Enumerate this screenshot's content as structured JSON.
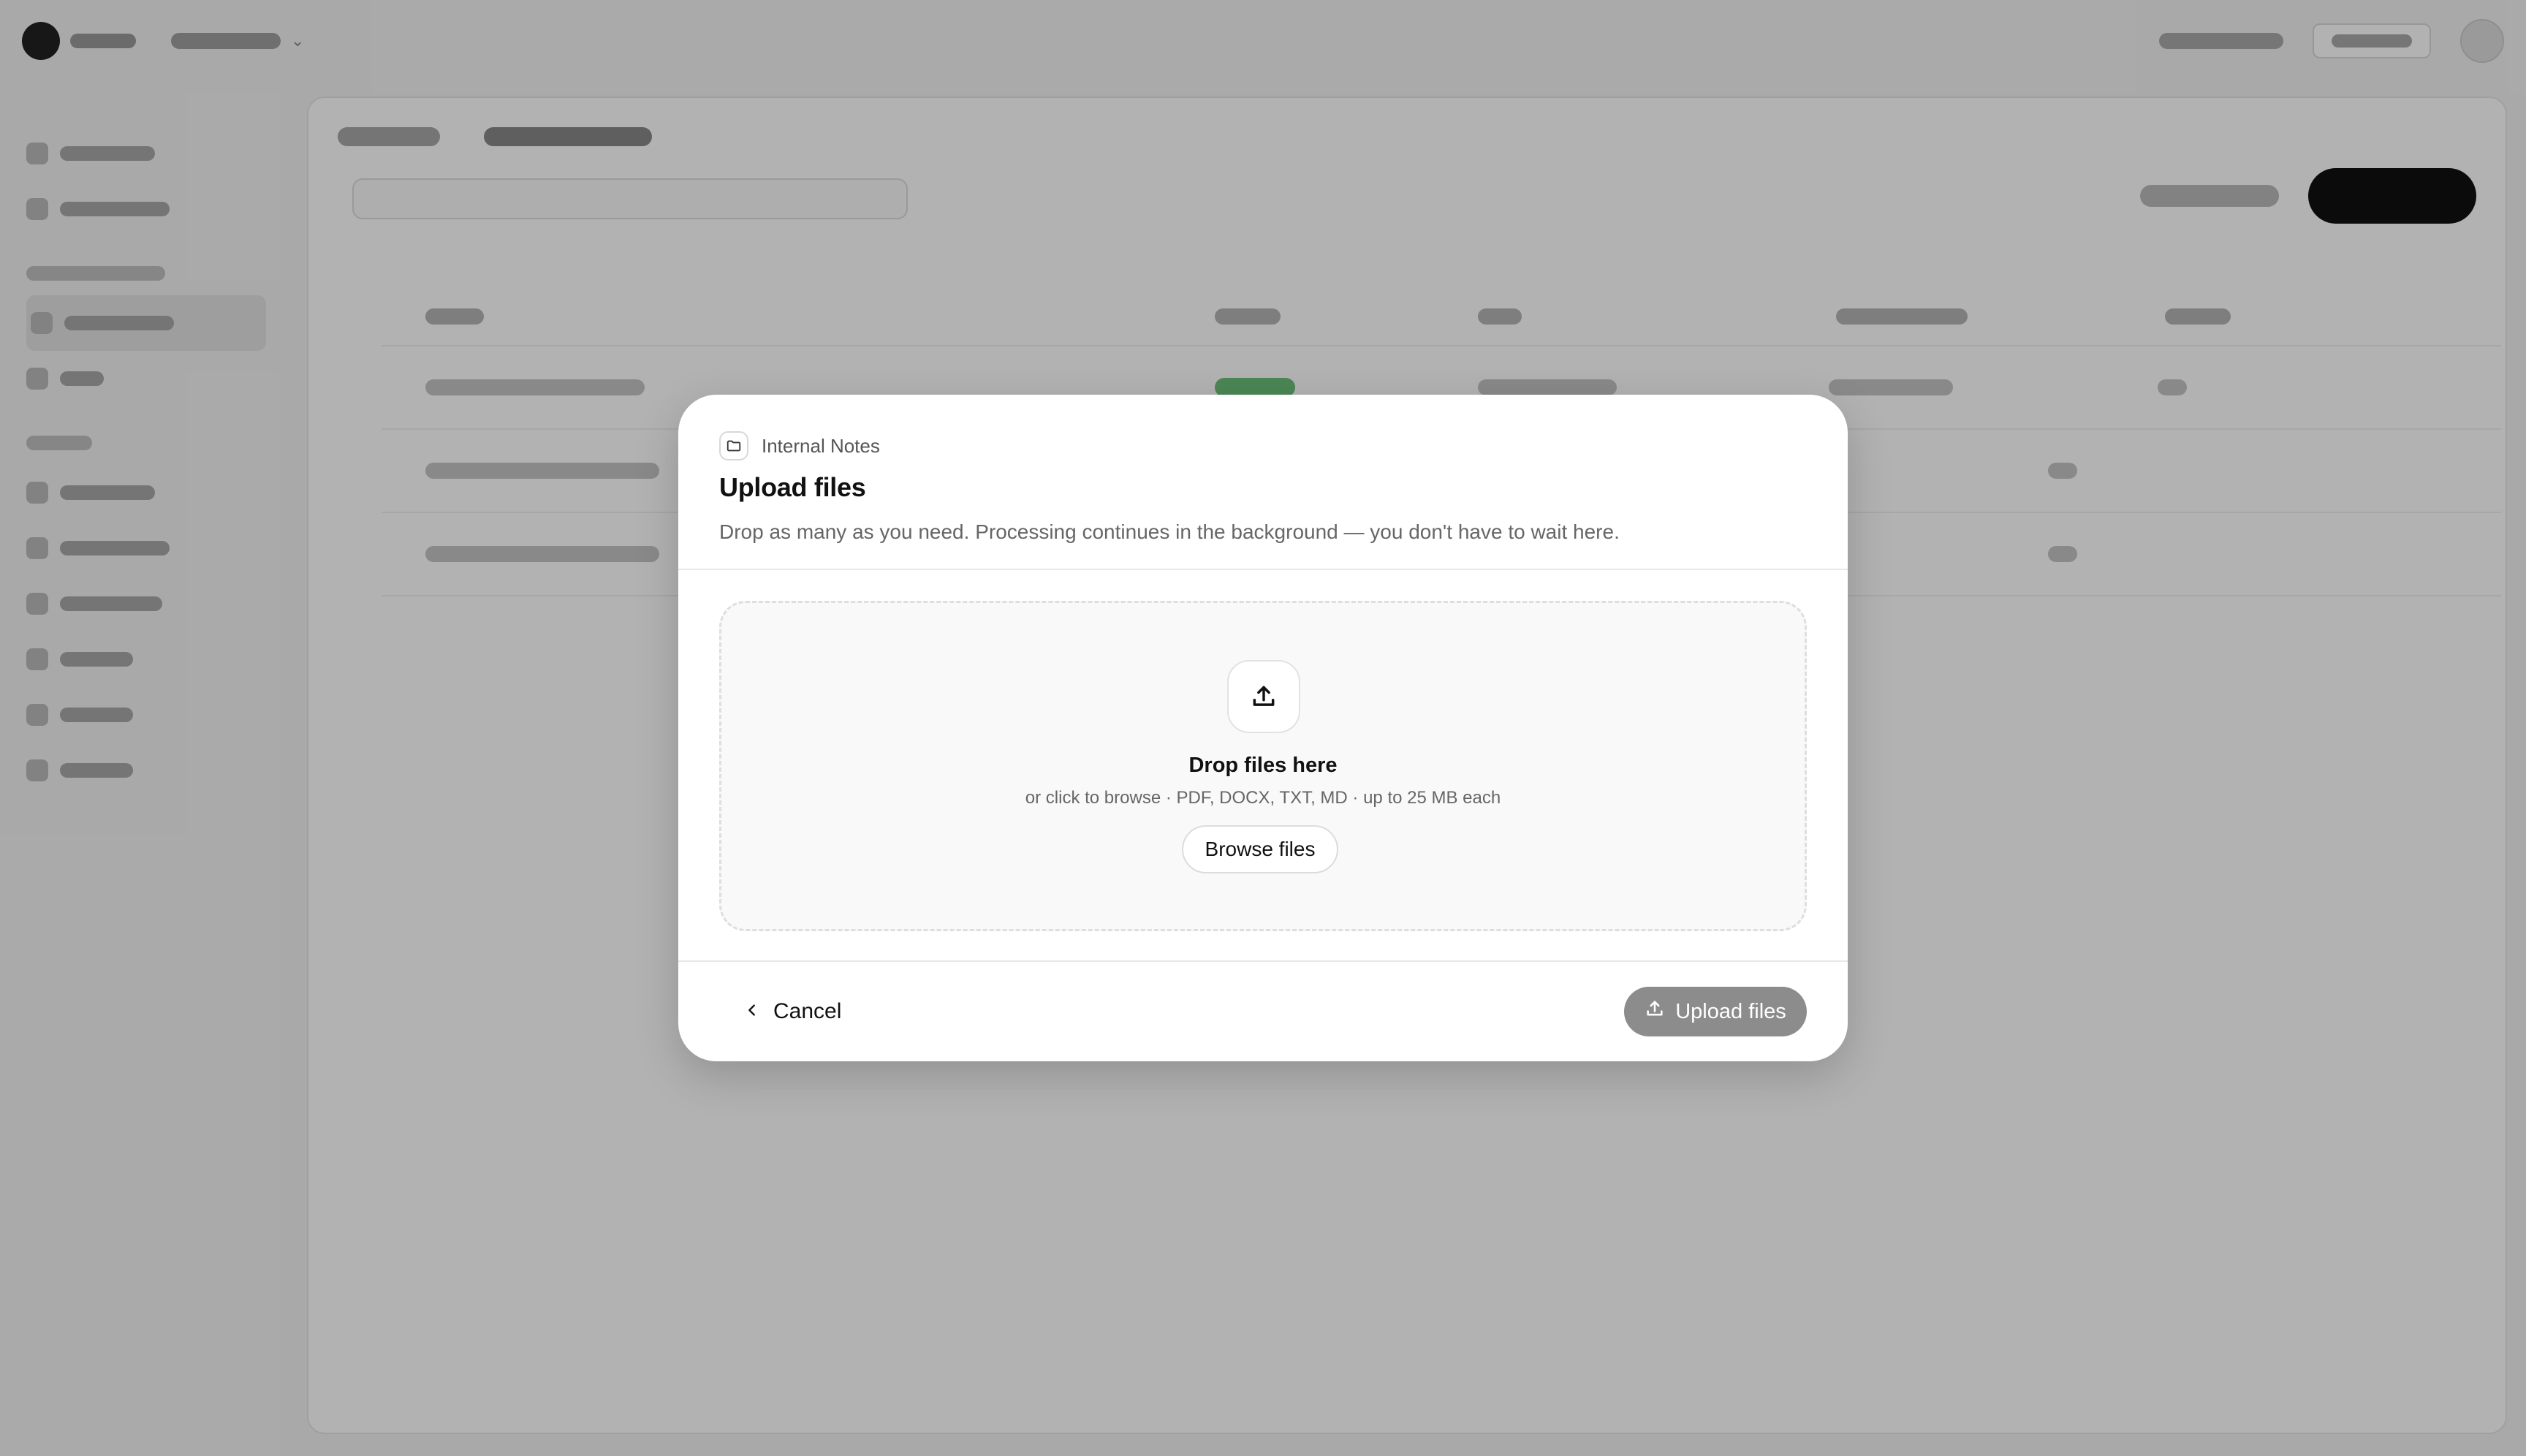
{
  "modal": {
    "breadcrumb": {
      "icon": "folder-icon",
      "label": "Internal Notes"
    },
    "title": "Upload files",
    "description": "Drop as many as you need. Processing continues in the background — you don't have to wait here.",
    "dropzone": {
      "icon": "upload-icon",
      "title": "Drop files here",
      "subtitle": "or click to browse · PDF, DOCX, TXT, MD · up to 25 MB each",
      "browse_label": "Browse files"
    },
    "footer": {
      "cancel_icon": "chevron-left-icon",
      "cancel_label": "Cancel",
      "upload_icon": "upload-icon",
      "upload_label": "Upload files"
    }
  },
  "colors": {
    "overlay": "#000000",
    "upload_button_disabled": "#8c8c8c",
    "status_ready": "#6cc07a"
  }
}
